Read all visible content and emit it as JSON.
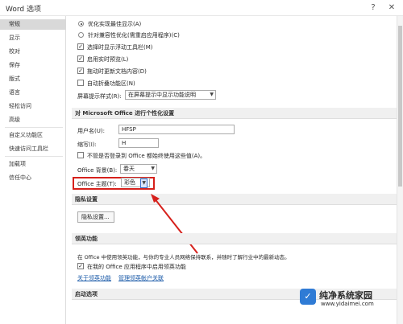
{
  "window": {
    "title": "Word 选项",
    "help": "?",
    "close": "✕"
  },
  "sidebar": {
    "items": [
      {
        "label": "常规"
      },
      {
        "label": "显示"
      },
      {
        "label": "校对"
      },
      {
        "label": "保存"
      },
      {
        "label": "版式"
      },
      {
        "label": "语言"
      },
      {
        "label": "轻松访问"
      },
      {
        "label": "高级"
      },
      {
        "label": "自定义功能区"
      },
      {
        "label": "快速访问工具栏"
      },
      {
        "label": "加载项"
      },
      {
        "label": "信任中心"
      }
    ],
    "active_index": 0
  },
  "ui_options": {
    "radio_optimize": "优化实现最佳显示(A)",
    "radio_compat": "针对兼容性优化(需重启应用程序)(C)",
    "cb_minitoolbar": "选择时显示浮动工具栏(M)",
    "cb_livepreview": "启用实时预览(L)",
    "cb_updatedrag": "拖动时更新文档内容(D)",
    "cb_collapse": "自动折叠功能区(N)",
    "tooltip_label": "屏幕提示样式(R):",
    "tooltip_value": "在屏幕提示中显示功能说明"
  },
  "personalize": {
    "header": "对 Microsoft Office 进行个性化设置",
    "username_label": "用户名(U):",
    "username_value": "HFSP",
    "initials_label": "缩写(I):",
    "initials_value": "H",
    "always_use_label": "不管是否登录到 Office 都始终使用这些值(A)。",
    "background_label": "Office 背景(B):",
    "background_value": "春天",
    "theme_label": "Office 主题(T):",
    "theme_value": "彩色"
  },
  "privacy": {
    "header": "隐私设置",
    "button": "隐私设置..."
  },
  "linkedin": {
    "header": "领英功能",
    "description": "在 Office 中使用领英功能，与你的专业人员网络保持联系，并随时了解行业中的最新动态。",
    "cb_label": "在我的 Office 应用程序中启用领英功能",
    "link_about": "关于领英功能",
    "link_manage": "管理领英帐户关联"
  },
  "startup": {
    "header": "启动选项"
  },
  "watermark": {
    "logo": "✓",
    "brand": "纯净系统家园",
    "url": "www.yidaimei.com"
  },
  "colors": {
    "highlight": "#d6201b",
    "link": "#1a5aa8"
  }
}
